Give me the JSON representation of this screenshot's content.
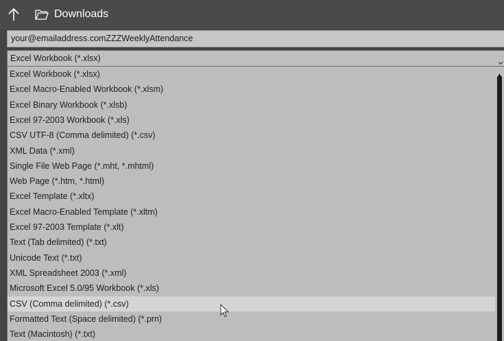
{
  "header": {
    "folder_name": "Downloads",
    "up_icon": "up-arrow-icon",
    "folder_icon": "folder-icon"
  },
  "filename": {
    "value": "your@emailaddress.comZZZWeeklyAttendance"
  },
  "file_type": {
    "selected": "Excel Workbook (*.xlsx)",
    "options": [
      "Excel Workbook (*.xlsx)",
      "Excel Macro-Enabled Workbook (*.xlsm)",
      "Excel Binary Workbook (*.xlsb)",
      "Excel 97-2003 Workbook (*.xls)",
      "CSV UTF-8 (Comma delimited) (*.csv)",
      "XML Data (*.xml)",
      "Single File Web Page (*.mht, *.mhtml)",
      "Web Page (*.htm, *.html)",
      "Excel Template (*.xltx)",
      "Excel Macro-Enabled Template (*.xltm)",
      "Excel 97-2003 Template (*.xlt)",
      "Text (Tab delimited) (*.txt)",
      "Unicode Text (*.txt)",
      "XML Spreadsheet 2003 (*.xml)",
      "Microsoft Excel 5.0/95 Workbook (*.xls)",
      "CSV (Comma delimited) (*.csv)",
      "Formatted Text (Space delimited) (*.prn)",
      "Text (Macintosh) (*.txt)"
    ],
    "hovered": "CSV (Comma delimited) (*.csv)"
  },
  "colors": {
    "header_bg": "#4a4a4a",
    "list_bg": "#bdbdbd",
    "hover_bg": "#d5d5d5",
    "scroll_thumb": "#1e1e1e"
  }
}
